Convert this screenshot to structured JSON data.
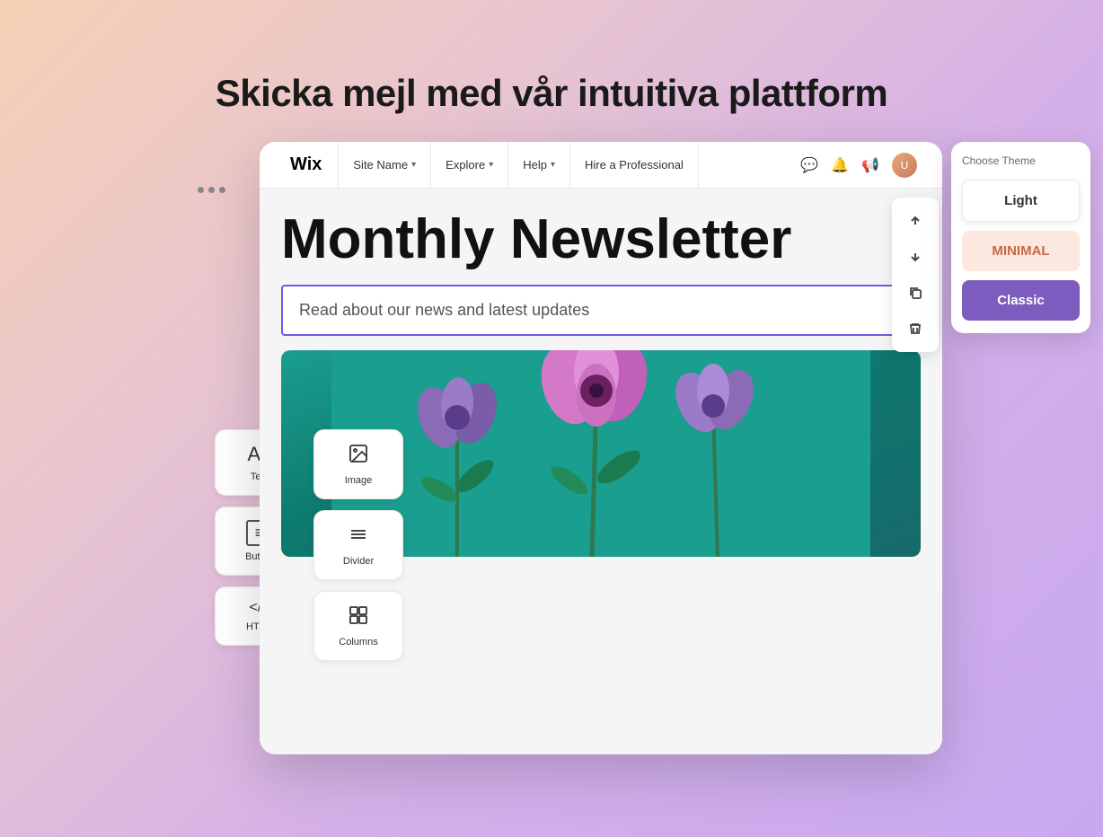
{
  "page": {
    "title": "Skicka mejl med vår intuitiva plattform"
  },
  "topbar": {
    "dots": "•••",
    "logo": "Wix",
    "nav": [
      {
        "label": "Site Name",
        "chevron": "▾"
      },
      {
        "label": "Explore",
        "chevron": "▾"
      },
      {
        "label": "Help",
        "chevron": "▾"
      },
      {
        "label": "Hire a Professional",
        "chevron": ""
      }
    ]
  },
  "left_panel": {
    "items": [
      {
        "icon": "Aa",
        "label": "Text"
      },
      {
        "icon": "🖼",
        "label": "Image"
      },
      {
        "icon": "⬛",
        "label": "Button"
      },
      {
        "icon": "≡",
        "label": "Divider"
      },
      {
        "icon": "</>",
        "label": "HTML"
      },
      {
        "icon": "⊞",
        "label": "Columns"
      }
    ]
  },
  "canvas": {
    "newsletter_title": "Monthly Newsletter",
    "subtitle": "Read about our news and latest updates"
  },
  "theme_panel": {
    "title": "Choose Theme",
    "themes": [
      {
        "label": "Light",
        "style": "light"
      },
      {
        "label": "MINIMAL",
        "style": "minimal"
      },
      {
        "label": "Classic",
        "style": "classic"
      }
    ]
  },
  "actions": {
    "up": "↑",
    "down": "↓",
    "copy": "⧉",
    "delete": "🗑"
  }
}
